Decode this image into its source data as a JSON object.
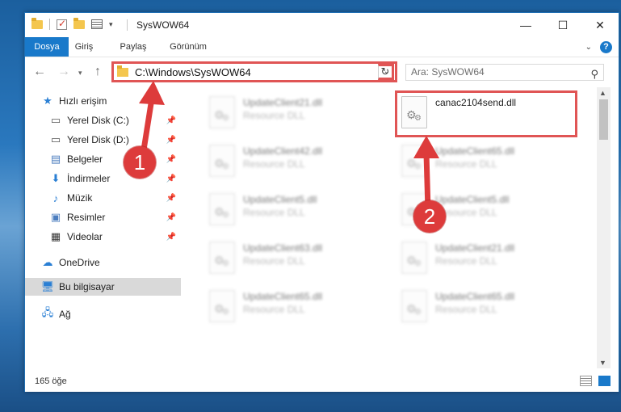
{
  "window": {
    "title": "SysWOW64"
  },
  "ribbon": {
    "tabs": [
      "Dosya",
      "Giriş",
      "Paylaş",
      "Görünüm"
    ]
  },
  "address": {
    "path": "C:\\Windows\\SysWOW64"
  },
  "search": {
    "placeholder": "Ara: SysWOW64"
  },
  "nav": {
    "quick_access": "Hızlı erişim",
    "items": [
      {
        "label": "Yerel Disk (C:)",
        "icon": "drive-icon",
        "pinned": true
      },
      {
        "label": "Yerel Disk (D:)",
        "icon": "drive-icon",
        "pinned": true
      },
      {
        "label": "Belgeler",
        "icon": "documents-icon",
        "pinned": true
      },
      {
        "label": "İndirmeler",
        "icon": "downloads-icon",
        "pinned": true
      },
      {
        "label": "Müzik",
        "icon": "music-icon",
        "pinned": true
      },
      {
        "label": "Resimler",
        "icon": "pictures-icon",
        "pinned": true
      },
      {
        "label": "Videolar",
        "icon": "videos-icon",
        "pinned": true
      }
    ],
    "onedrive": "OneDrive",
    "this_pc": "Bu bilgisayar",
    "network": "Ağ"
  },
  "files": {
    "highlighted": {
      "name": "canac2104send.dll"
    },
    "left_column": [
      {
        "name": "UpdateClient21.dll",
        "type": "Resource DLL"
      },
      {
        "name": "UpdateClient42.dll",
        "type": "Resource DLL"
      },
      {
        "name": "UpdateClient5.dll",
        "type": "Resource DLL"
      },
      {
        "name": "UpdateClient63.dll",
        "type": "Resource DLL"
      },
      {
        "name": "UpdateClient65.dll",
        "type": "Resource DLL"
      }
    ],
    "right_column": [
      {
        "name": "UpdateClient65.dll",
        "type": "Resource DLL"
      },
      {
        "name": "UpdateClient5.dll",
        "type": "Resource DLL"
      },
      {
        "name": "UpdateClient21.dll",
        "type": "Resource DLL"
      },
      {
        "name": "UpdateClient65.dll",
        "type": "Resource DLL"
      }
    ]
  },
  "status": {
    "count": "165 öğe"
  },
  "callouts": {
    "one": "1",
    "two": "2"
  },
  "colors": {
    "accent": "#1979ca",
    "callout": "#dd3b3b"
  }
}
